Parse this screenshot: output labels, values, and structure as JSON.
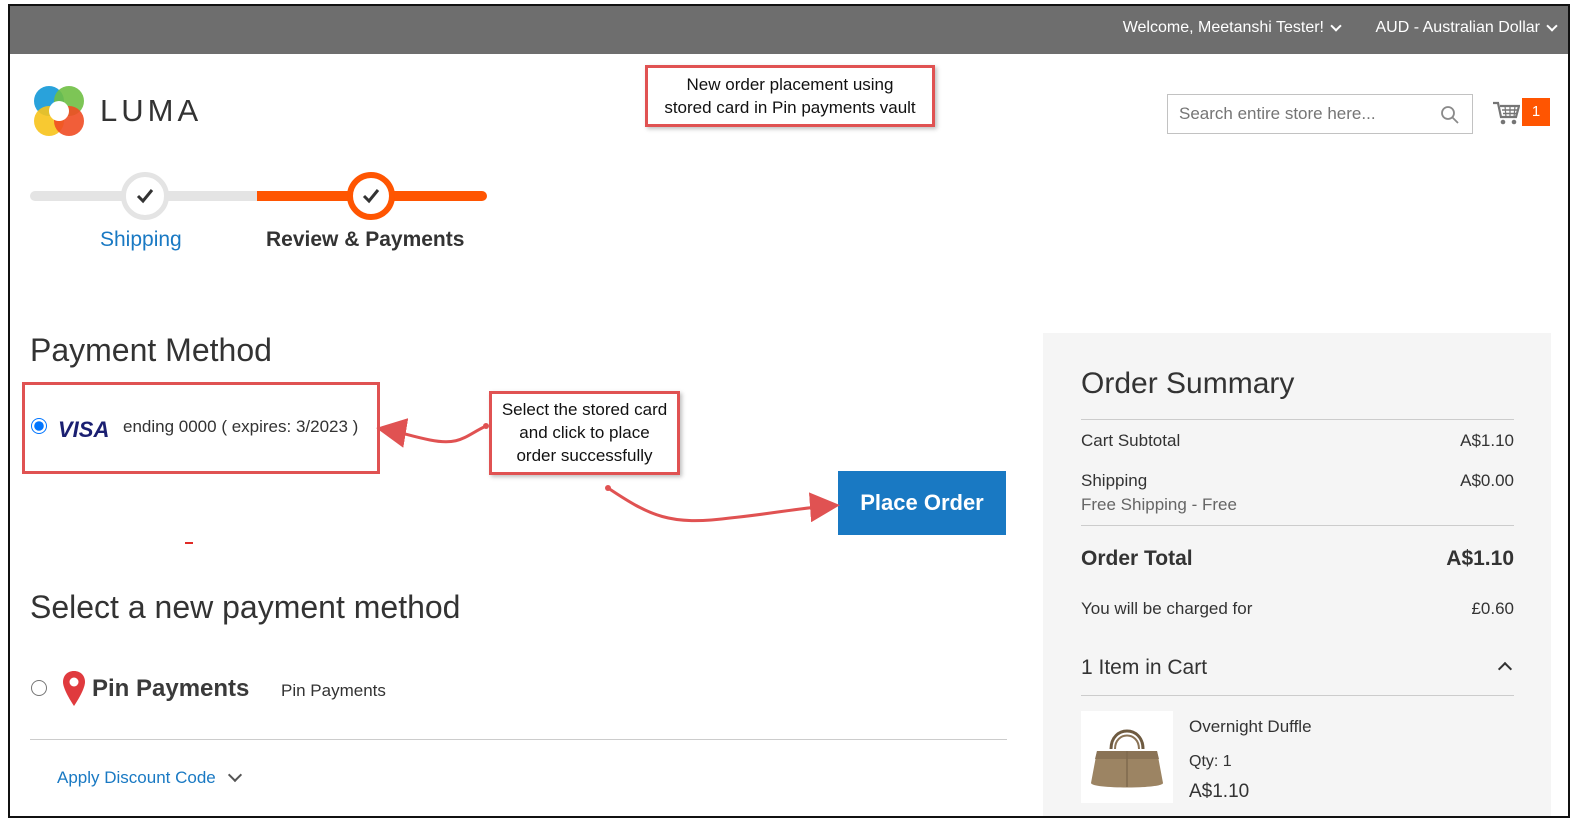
{
  "header": {
    "welcome": "Welcome, Meetanshi Tester!",
    "currency": "AUD - Australian Dollar",
    "logo_text": "LUMA",
    "search_placeholder": "Search entire store here...",
    "cart_count": "1"
  },
  "annotations": {
    "top_line1": "New order placement using",
    "top_line2": "stored card in Pin payments vault",
    "mid_line1": "Select the stored card",
    "mid_line2": "and click to place",
    "mid_line3": "order successfully"
  },
  "progress": {
    "steps": [
      {
        "label": "Shipping"
      },
      {
        "label": "Review & Payments"
      }
    ]
  },
  "payment": {
    "title": "Payment Method",
    "stored_card": {
      "brand": "VISA",
      "description": "ending 0000 ( expires: 3/2023 )"
    },
    "place_order_label": "Place Order",
    "new_method_title": "Select a new payment method",
    "pin_logo_text": "Pin Payments",
    "pin_label": "Pin Payments",
    "discount_label": "Apply Discount Code"
  },
  "summary": {
    "title": "Order Summary",
    "cart_subtotal_label": "Cart Subtotal",
    "cart_subtotal_value": "A$1.10",
    "shipping_label": "Shipping",
    "shipping_value": "A$0.00",
    "shipping_method": "Free Shipping - Free",
    "order_total_label": "Order Total",
    "order_total_value": "A$1.10",
    "charged_label": "You will be charged for",
    "charged_value": "£0.60",
    "items_label": "1 Item in Cart",
    "product": {
      "name": "Overnight Duffle",
      "qty": "Qty: 1",
      "price": "A$1.10"
    }
  },
  "colors": {
    "accent": "#ff5501",
    "link": "#1979c3",
    "annotation": "#e05252",
    "topbar": "#6e6e6e"
  }
}
